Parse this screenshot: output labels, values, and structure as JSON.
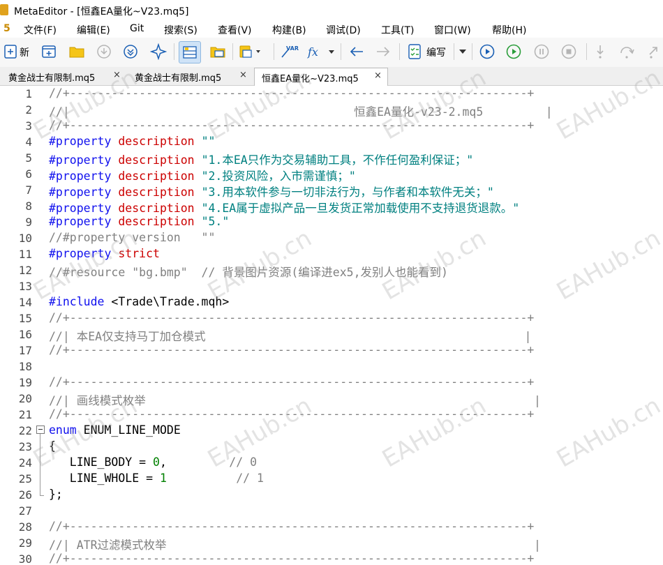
{
  "window": {
    "title": "MetaEditor - [恒鑫EA量化~V23.mq5]"
  },
  "menu": [
    "文件(F)",
    "编辑(E)",
    "Git",
    "搜索(S)",
    "查看(V)",
    "构建(B)",
    "调试(D)",
    "工具(T)",
    "窗口(W)",
    "帮助(H)"
  ],
  "menu_badge": "5",
  "toolbar": {
    "new_label": "新",
    "compile_label": "编写",
    "var_label": "VAR",
    "fx_label": "fx"
  },
  "tabs": [
    {
      "label": "黄金战士有限制.mq5",
      "close": "×"
    },
    {
      "label": "黄金战士有限制.mq5",
      "close": "×"
    },
    {
      "label": "恒鑫EA量化~V23.mq5",
      "close": "×"
    }
  ],
  "editor": {
    "line_numbers": [
      "1",
      "2",
      "3",
      "4",
      "5",
      "6",
      "7",
      "8",
      "9",
      "10",
      "11",
      "12",
      "13",
      "14",
      "15",
      "16",
      "17",
      "18",
      "19",
      "20",
      "21",
      "22",
      "23",
      "24",
      "25",
      "26",
      "27",
      "28",
      "29",
      "30"
    ],
    "code": {
      "l1": "//+------------------------------------------------------------------+",
      "l2": "//|                                         恒鑫EA量化-v23-2.mq5         |",
      "l3": "//+------------------------------------------------------------------+",
      "kw_property": "#property",
      "kw_description": "description",
      "l4_str": "\"\"",
      "l5_str": "\"1.本EA只作为交易辅助工具，不作任何盈利保证；\"",
      "l6_str": "\"2.投资风险，入市需谨慎；\"",
      "l7_str": "\"3.用本软件参与一切非法行为，与作者和本软件无关；\"",
      "l8_str": "\"4.EA属于虚拟产品一旦发货正常加载使用不支持退货退款。\"",
      "l9_str": "\"5.\"",
      "l10": "//#property version   \"\"",
      "kw_strict": "strict",
      "l12": "//#resource \"bg.bmp\"  // 背景图片资源(编译进ex5,发别人也能看到)",
      "kw_include": "#include",
      "l14_rest": " <Trade\\Trade.mqh>",
      "l15": "//+------------------------------------------------------------------+",
      "l16": "//| 本EA仅支持马丁加仓模式                                              |",
      "l17": "//+------------------------------------------------------------------+",
      "l19": "//+------------------------------------------------------------------+",
      "l20": "//| 画线模式枚举                                                        |",
      "l21": "//+------------------------------------------------------------------+",
      "kw_enum": "enum",
      "l22_rest": " ENUM_LINE_MODE",
      "l23": "{",
      "l24_a": "   LINE_BODY = ",
      "l24_num": "0",
      "l24_b": ",         ",
      "l24_cmt": "// 0",
      "l25_a": "   LINE_WHOLE = ",
      "l25_num": "1",
      "l25_b": "          ",
      "l25_cmt": "// 1",
      "l26": "};",
      "l28": "//+------------------------------------------------------------------+",
      "l29": "//| ATR过滤模式枚举                                                     |",
      "l30": "//+------------------------------------------------------------------+"
    }
  },
  "watermark": "EAHub.cn",
  "colors": {
    "keyword": "#1010ee",
    "property_name": "#cc0000",
    "string": "#008080",
    "comment": "#808080",
    "number": "#008000"
  }
}
